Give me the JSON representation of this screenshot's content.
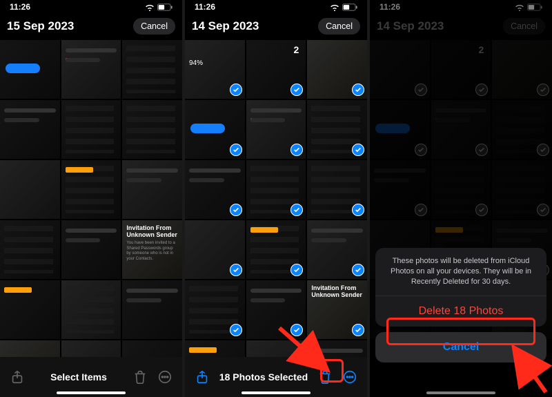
{
  "panels": [
    {
      "time": "11:26",
      "date_title": "15 Sep 2023",
      "cancel": "Cancel",
      "toolbar_center": "Select Items",
      "invitation_title": "Invitation From Unknown Sender",
      "invitation_body": "You have been invited to a Shared Passwords group by someone who is not in your Contacts."
    },
    {
      "time": "11:26",
      "date_title": "14 Sep 2023",
      "cancel": "Cancel",
      "toolbar_center": "18 Photos Selected",
      "battery_pct": "94%",
      "invitation_title": "Invitation From Unknown Sender"
    },
    {
      "time": "11:26",
      "date_title": "14 Sep 2023",
      "cancel": "Cancel",
      "sheet_message": "These photos will be deleted from iCloud Photos on all your devices. They will be in Recently Deleted for 30 days.",
      "delete_label": "Delete 18 Photos",
      "sheet_cancel": "Cancel"
    }
  ],
  "gauge_label": "2"
}
